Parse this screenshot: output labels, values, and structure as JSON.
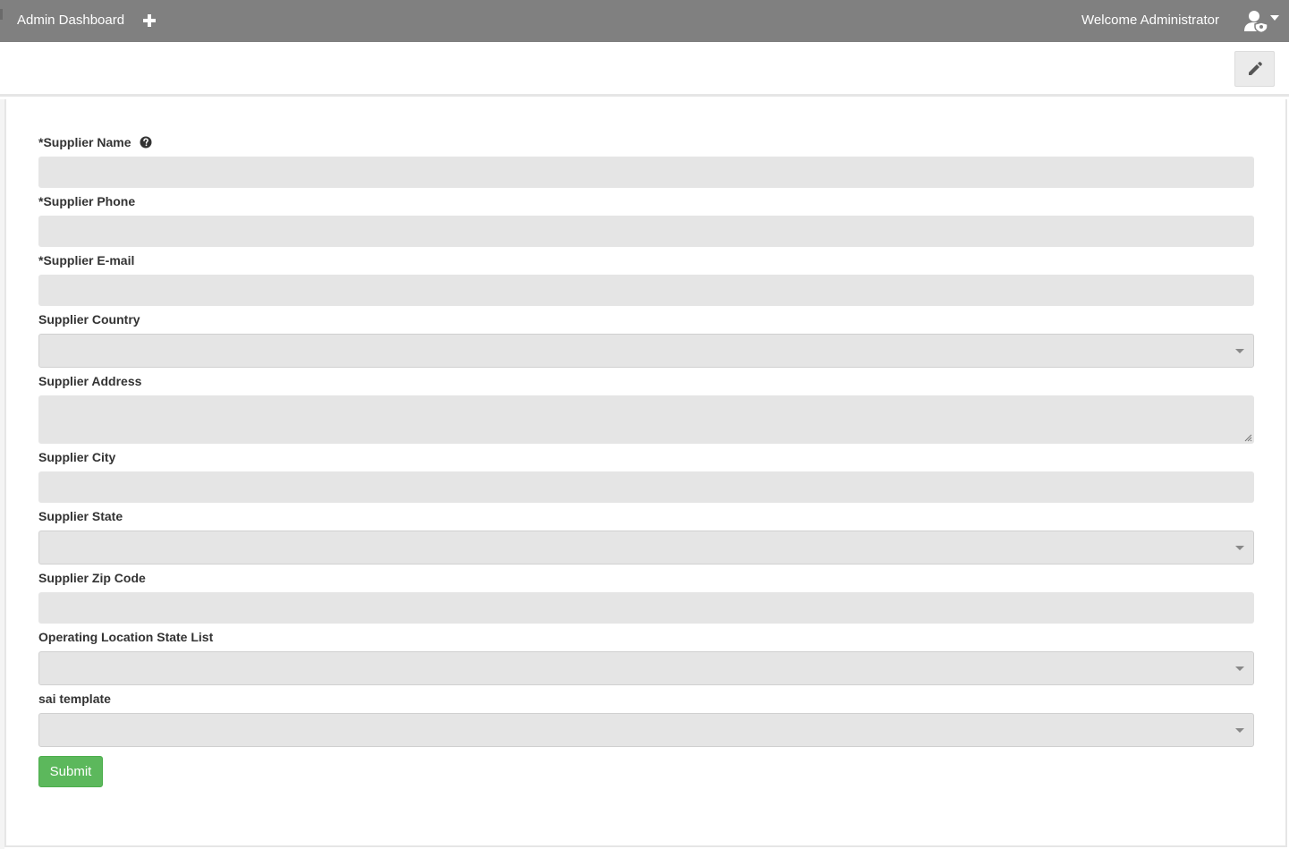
{
  "header": {
    "brand": "Admin Dashboard",
    "add_icon": "plus-icon",
    "welcome": "Welcome Administrator",
    "user_icon": "user-shield-icon",
    "menu_icon": "caret-down-icon",
    "bg_color": "#808080"
  },
  "toolbar": {
    "edit_icon": "pencil-icon"
  },
  "form": {
    "supplier_name": {
      "label": "*Supplier Name",
      "help_icon": "question-circle-icon",
      "value": ""
    },
    "supplier_phone": {
      "label": "*Supplier Phone",
      "value": ""
    },
    "supplier_email": {
      "label": "*Supplier E-mail",
      "value": ""
    },
    "supplier_country": {
      "label": "Supplier Country",
      "value": ""
    },
    "supplier_address": {
      "label": "Supplier Address",
      "value": ""
    },
    "supplier_city": {
      "label": "Supplier City",
      "value": ""
    },
    "supplier_state": {
      "label": "Supplier State",
      "value": ""
    },
    "supplier_zip": {
      "label": "Supplier Zip Code",
      "value": ""
    },
    "operating_states": {
      "label": "Operating Location State List",
      "value": ""
    },
    "sai_template": {
      "label": "sai template",
      "value": ""
    },
    "submit_label": "Submit",
    "submit_color": "#5cb85c",
    "field_bg": "#e5e5e5"
  }
}
